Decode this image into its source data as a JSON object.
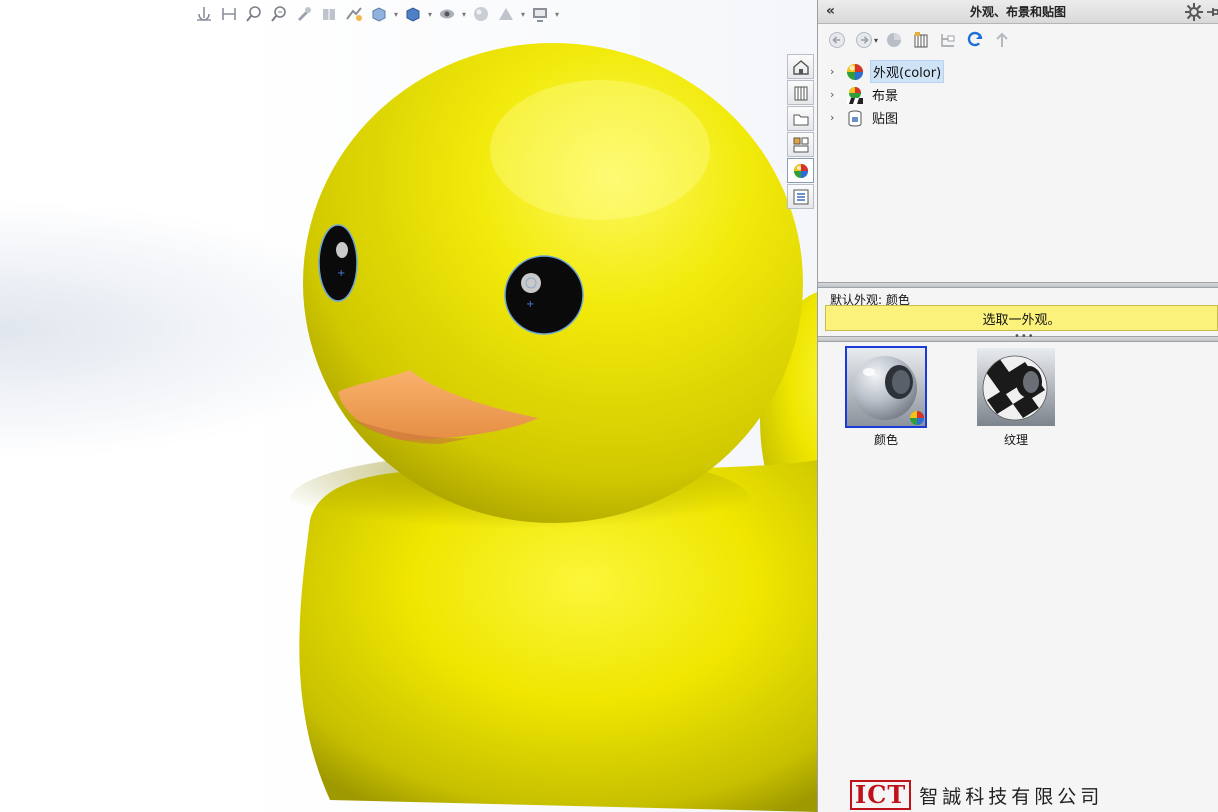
{
  "taskpane": {
    "title": "外观、布景和贴图",
    "collapse_glyph": "«",
    "tree": [
      {
        "label": "外观(color)",
        "icon": "appearance-sphere-icon",
        "selected": true
      },
      {
        "label": "布景",
        "icon": "scene-icon",
        "selected": false
      },
      {
        "label": "贴图",
        "icon": "decal-icon",
        "selected": false
      }
    ],
    "info_label": "默认外观: 颜色",
    "hint": "选取一外观。",
    "gallery": [
      {
        "label": "颜色",
        "icon": "color-appearance-thumbnail",
        "selected": true
      },
      {
        "label": "纹理",
        "icon": "texture-appearance-thumbnail",
        "selected": false
      }
    ]
  },
  "watermark": {
    "mark": "ICT",
    "name": "智誠科技有限公司"
  },
  "colors": {
    "duck_yellow": "#f0ea00",
    "beak_orange": "#f4a35a",
    "hint_bg": "#fbf27c",
    "selection_blue": "#1a3bd8",
    "logo_red": "#c0121a"
  }
}
